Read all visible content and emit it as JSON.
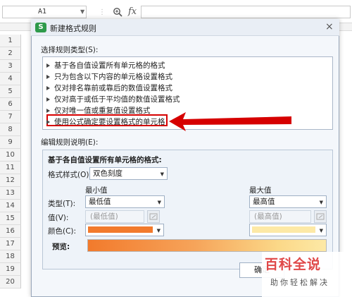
{
  "formula_bar": {
    "cell_reference": "A1",
    "fx_label": "fx"
  },
  "rows": [
    "1",
    "2",
    "3",
    "4",
    "5",
    "6",
    "7",
    "8",
    "9",
    "10",
    "11",
    "12",
    "13",
    "14",
    "15",
    "16",
    "17",
    "18",
    "19",
    "20"
  ],
  "dialog": {
    "title": "新建格式规则",
    "close_label": "×",
    "rule_type_label": "选择规则类型(S):",
    "rule_types": [
      "基于各自值设置所有单元格的格式",
      "只为包含以下内容的单元格设置格式",
      "仅对排名靠前或靠后的数值设置格式",
      "仅对高于或低于平均值的数值设置格式",
      "仅对唯一值或重复值设置格式",
      "使用公式确定要设置格式的单元格"
    ],
    "edit_label": "编辑规则说明(E):",
    "edit_heading": "基于各自值设置所有单元格的格式:",
    "format_style_label": "格式样式(O):",
    "format_style_value": "双色刻度",
    "min_header": "最小值",
    "max_header": "最大值",
    "type_label": "类型(T):",
    "min_type": "最低值",
    "max_type": "最高值",
    "value_label": "值(V):",
    "min_value": "(最低值)",
    "max_value": "(最高值)",
    "color_label": "颜色(C):",
    "min_color": "#f27a2c",
    "max_color": "#fde9a6",
    "preview_label": "预览:",
    "ok_label": "确定"
  },
  "annotation": {
    "color": "#d60000"
  },
  "watermark": {
    "main": "百科全说",
    "sub": "助你轻松解决"
  }
}
